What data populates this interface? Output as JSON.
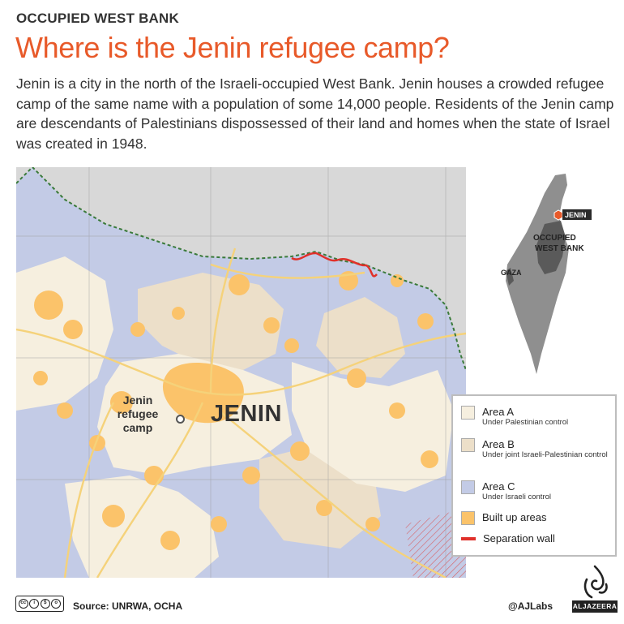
{
  "header": {
    "kicker": "OCCUPIED WEST BANK",
    "headline": "Where is the Jenin refugee camp?",
    "dek": "Jenin is a city in the north of the Israeli-occupied West Bank. Jenin houses a crowded refugee camp of the same name with a population of some 14,000 people. Residents of the Jenin camp are descendants of Palestinians dispossessed of their land and homes when the state of Israel was created in 1948."
  },
  "map": {
    "city_label": "JENIN",
    "camp_label": "Jenin refugee camp",
    "icon": "camp-marker-circle"
  },
  "inset": {
    "jenin_label": "JENIN",
    "west_bank_label": "OCCUPIED WEST BANK",
    "gaza_label": "GAZA"
  },
  "legend": {
    "items": [
      {
        "title": "Area A",
        "subtitle": "Under Palestinian control",
        "color": "#f6efdf"
      },
      {
        "title": "Area B",
        "subtitle": "Under joint Israeli-Palestinian control",
        "color": "#ecdfc9"
      },
      {
        "title": "Area C",
        "subtitle": "Under Israeli control",
        "color": "#c3cbe6"
      },
      {
        "title": "Built up areas",
        "subtitle": "",
        "color": "#fbc36a"
      },
      {
        "title": "Separation wall",
        "subtitle": "",
        "color": "#e0302a"
      }
    ]
  },
  "footer": {
    "source": "Source: UNRWA, OCHA",
    "handle": "@AJLabs",
    "brand": "ALJAZEERA",
    "license": "cc by nc sa"
  },
  "colors": {
    "headline": "#e85a2a",
    "area_a": "#f6efdf",
    "area_b": "#ecdfc9",
    "area_c": "#c3cbe6",
    "built_up": "#fbc36a",
    "wall": "#e0302a",
    "outside": "#d8d8d8"
  }
}
